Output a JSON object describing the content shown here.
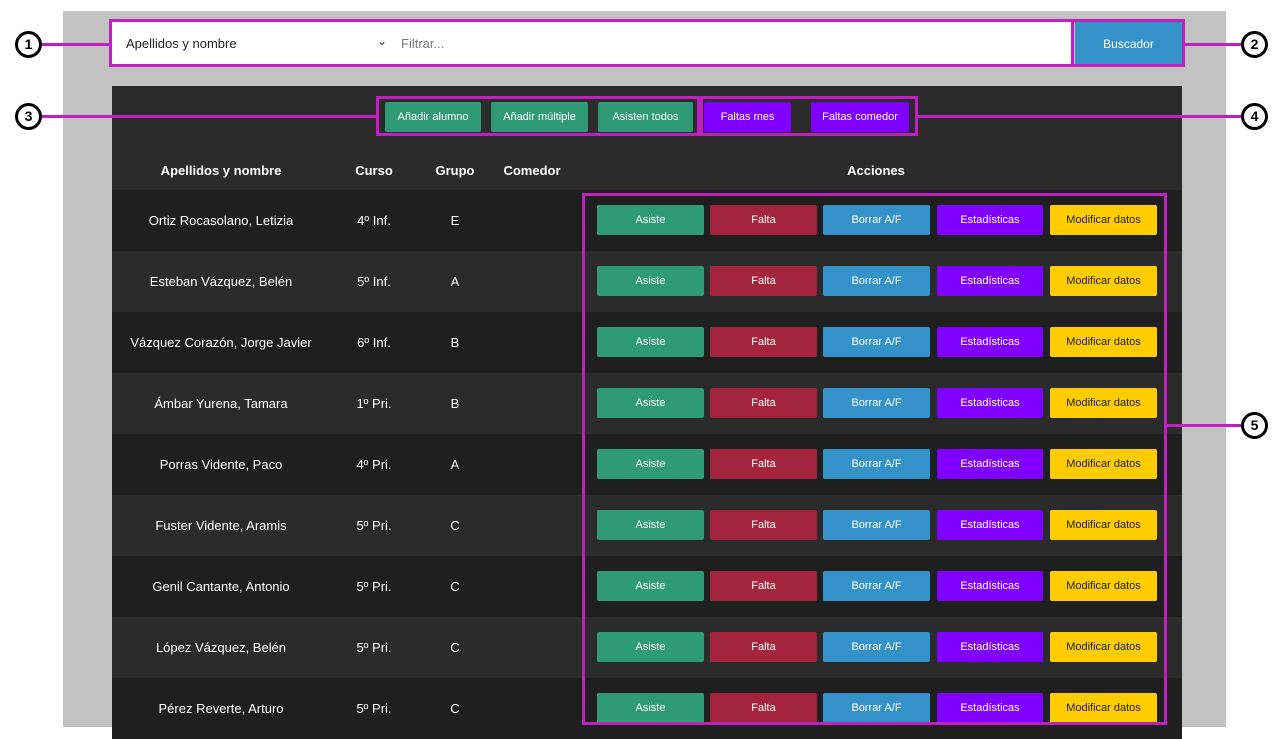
{
  "search": {
    "select_value": "Apellidos y nombre",
    "placeholder": "Filtrar...",
    "button_label": "Buscador"
  },
  "toolbar": {
    "add_student": "Añadir alumno",
    "add_multiple": "Añadir múltiple",
    "all_attend": "Asisten todos",
    "month_absences": "Faltas mes",
    "canteen_absences": "Faltas comedor"
  },
  "table": {
    "headers": {
      "name": "Apellidos y nombre",
      "course": "Curso",
      "group": "Grupo",
      "canteen": "Comedor",
      "actions": "Acciones"
    },
    "rows": [
      {
        "name": "Ortiz Rocasolano, Letizia",
        "course": "4º Inf.",
        "group": "E"
      },
      {
        "name": "Esteban Vázquez, Belén",
        "course": "5º Inf.",
        "group": "A"
      },
      {
        "name": "Vázquez Corazón, Jorge Javier",
        "course": "6º Inf.",
        "group": "B"
      },
      {
        "name": "Ámbar Yurena, Tamara",
        "course": "1º Pri.",
        "group": "B"
      },
      {
        "name": "Porras Vidente, Paco",
        "course": "4º Pri.",
        "group": "A"
      },
      {
        "name": "Fuster Vidente, Aramis",
        "course": "5º Pri.",
        "group": "C"
      },
      {
        "name": "Genil Cantante, Antonio",
        "course": "5º Pri.",
        "group": "C"
      },
      {
        "name": "López Vázquez, Belén",
        "course": "5º Pri.",
        "group": "C"
      },
      {
        "name": "Pérez Reverte, Arturo",
        "course": "5º Pri.",
        "group": "C"
      }
    ],
    "actions": {
      "attend": "Asiste",
      "absent": "Falta",
      "clear": "Borrar A/F",
      "stats": "Estadísticas",
      "edit": "Modificar datos"
    }
  },
  "annotations": [
    "1",
    "2",
    "3",
    "4",
    "5"
  ],
  "colors": {
    "green": "#2f9a76",
    "purple": "#8000ff",
    "red": "#a3243c",
    "blue": "#3492c9",
    "yellow": "#ffcc00",
    "annotation": "#c020c0"
  }
}
